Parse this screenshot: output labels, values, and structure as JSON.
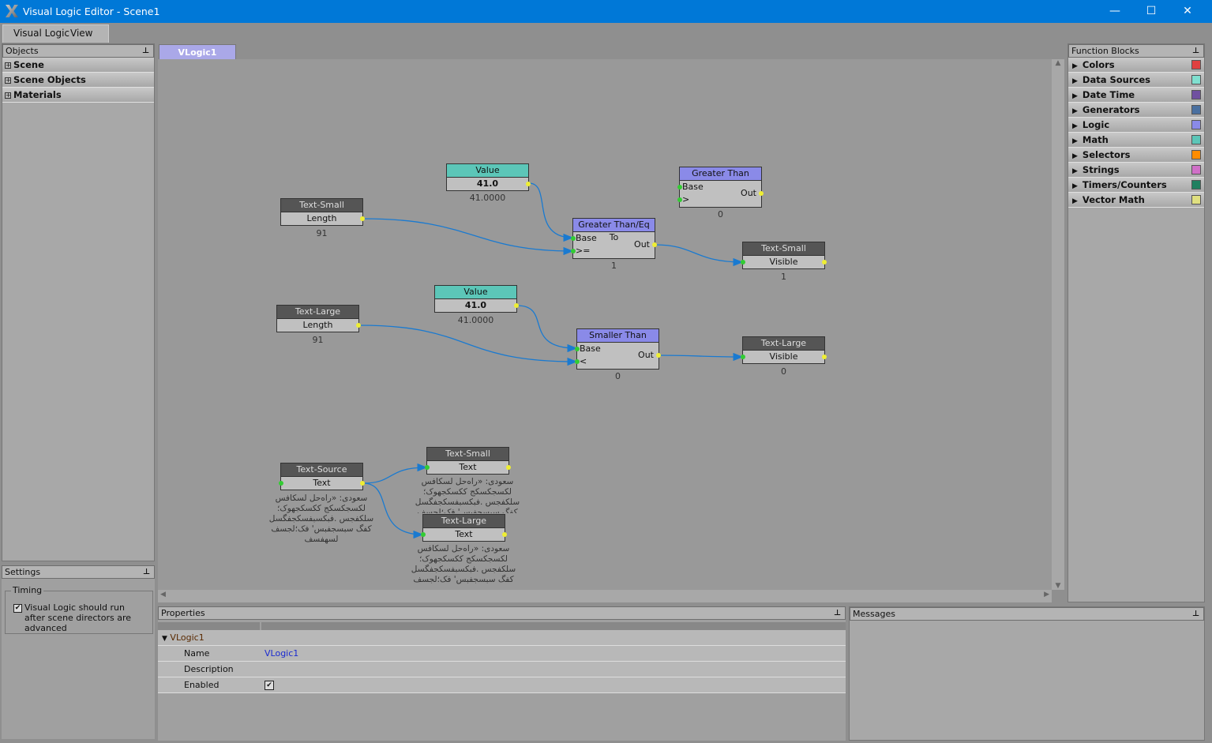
{
  "window": {
    "title": "Visual Logic Editor - Scene1",
    "minimize": "—",
    "maximize": "☐",
    "close": "✕"
  },
  "menu": [
    "Visual Logic",
    "View"
  ],
  "objects": {
    "title": "Objects",
    "items": [
      "Scene",
      "Scene Objects",
      "Materials"
    ]
  },
  "settings": {
    "title": "Settings",
    "group": "Timing",
    "checkbox_label": "Visual Logic should run after scene directors are advanced",
    "checked": true
  },
  "tab": "VLogic1",
  "function_blocks": {
    "title": "Function Blocks",
    "items": [
      {
        "label": "Colors",
        "color": "#e04040"
      },
      {
        "label": "Data Sources",
        "color": "#80e0d0"
      },
      {
        "label": "Date Time",
        "color": "#7050a0"
      },
      {
        "label": "Generators",
        "color": "#4a70a0"
      },
      {
        "label": "Logic",
        "color": "#8a8ae8"
      },
      {
        "label": "Math",
        "color": "#5cc6b8"
      },
      {
        "label": "Selectors",
        "color": "#ff8c00"
      },
      {
        "label": "Strings",
        "color": "#d070c8"
      },
      {
        "label": "Timers/Counters",
        "color": "#208060"
      },
      {
        "label": "Vector Math",
        "color": "#e0e080"
      }
    ]
  },
  "nodes": {
    "value1": {
      "title": "Value",
      "row": "41.0",
      "value": "41.0000"
    },
    "text_small1": {
      "title": "Text-Small",
      "row": "Length",
      "value": "91"
    },
    "gte": {
      "title": "Greater Than/Eq To",
      "in1": "Base",
      "in2": ">=",
      "out": "Out",
      "value": "1"
    },
    "gt": {
      "title": "Greater Than",
      "in1": "Base",
      "in2": ">",
      "out": "Out",
      "value": "0"
    },
    "text_small_vis": {
      "title": "Text-Small",
      "row": "Visible",
      "value": "1"
    },
    "value2": {
      "title": "Value",
      "row": "41.0",
      "value": "41.0000"
    },
    "text_large1": {
      "title": "Text-Large",
      "row": "Length",
      "value": "91"
    },
    "lt": {
      "title": "Smaller Than",
      "in1": "Base",
      "in2": "<",
      "out": "Out",
      "value": "0"
    },
    "text_large_vis": {
      "title": "Text-Large",
      "row": "Visible",
      "value": "0"
    },
    "text_source": {
      "title": "Text-Source",
      "row": "Text",
      "value": "سعودی: «راه‌حل لسکافس لکسجکسکج ککسکجهوک؛ سلکفجس .فبکسبفسکجفگسل کفگ سبسجفبس' فک؛لجسف لسهفسف"
    },
    "text_small_text": {
      "title": "Text-Small",
      "row": "Text",
      "value": "سعودی: «راه‌حل لسکافس لکسجکسکج ککسکجهوک؛ سلکفجس .فبکسبفسکجفگسل کفگ سبسجفبس' فک؛لجسف"
    },
    "text_large_text": {
      "title": "Text-Large",
      "row": "Text",
      "value": "سعودی: «راه‌حل لسکافس لکسجکسکج ککسکجهوک؛ سلکفجس .فبکسبفسکجفگسل کفگ سبسجفبس' فک؛لجسف"
    }
  },
  "properties": {
    "title": "Properties",
    "object": "VLogic1",
    "rows": [
      {
        "label": "Name",
        "value": "VLogic1"
      },
      {
        "label": "Description",
        "value": ""
      },
      {
        "label": "Enabled",
        "value": "✔"
      }
    ]
  },
  "messages": {
    "title": "Messages"
  }
}
